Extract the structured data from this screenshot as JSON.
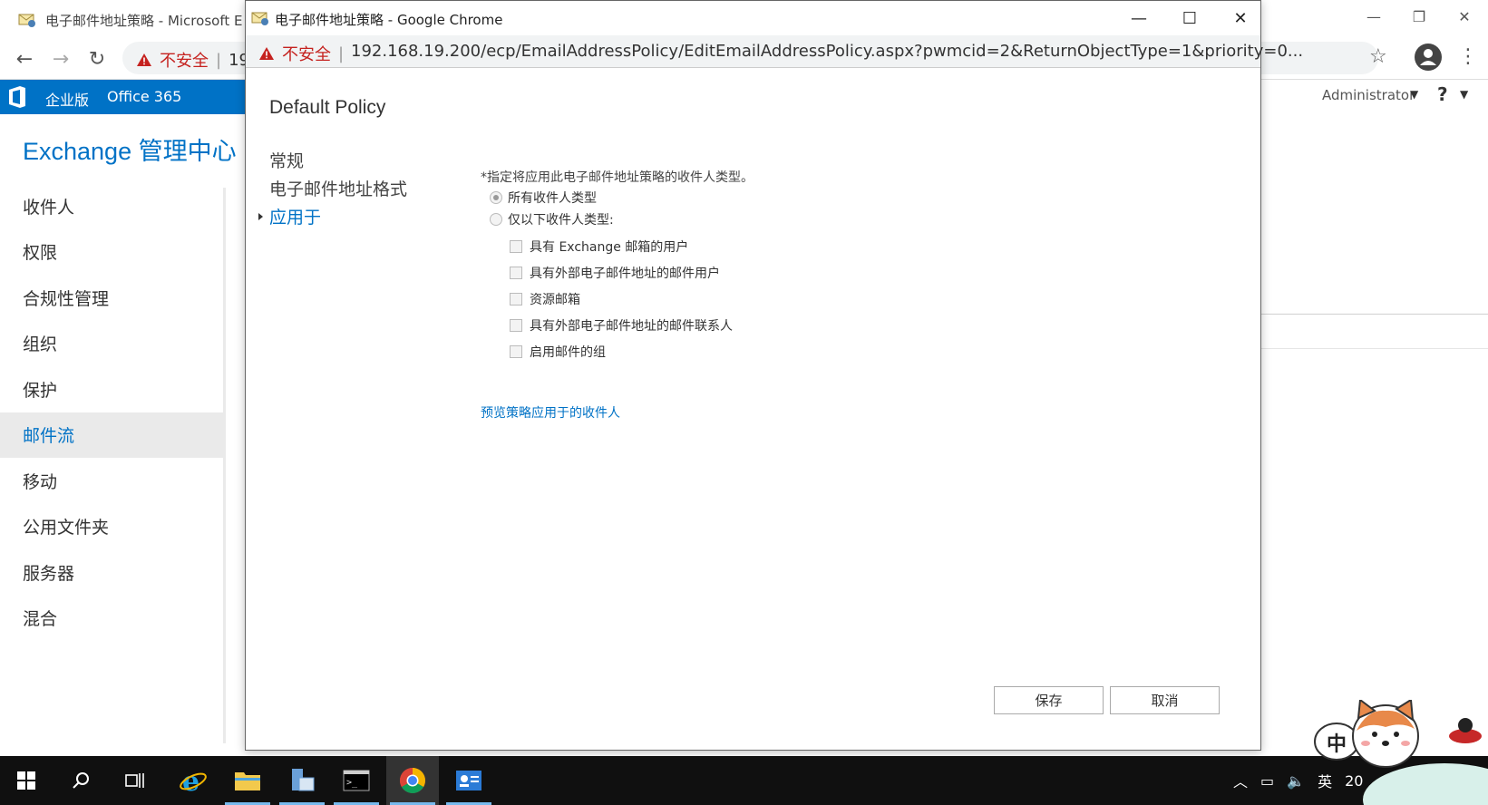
{
  "background_window": {
    "tab_title": "电子邮件地址策略 - Microsoft E",
    "security_label": "不安全",
    "url_fragment": "19"
  },
  "office_bar": {
    "enterprise_label": "企业版",
    "product_label": "Office 365",
    "user_name": "Administrator",
    "help_label": "?"
  },
  "eac": {
    "title": "Exchange 管理中心",
    "nav": [
      {
        "label": "收件人"
      },
      {
        "label": "权限"
      },
      {
        "label": "合规性管理"
      },
      {
        "label": "组织"
      },
      {
        "label": "保护"
      },
      {
        "label": "邮件流",
        "active": true
      },
      {
        "label": "移动"
      },
      {
        "label": "公用文件夹"
      },
      {
        "label": "服务器"
      },
      {
        "label": "混合"
      }
    ]
  },
  "popup": {
    "window_title": "电子邮件地址策略 - Google Chrome",
    "security_label": "不安全",
    "url": "192.168.19.200/ecp/EmailAddressPolicy/EditEmailAddressPolicy.aspx?pwmcid=2&ReturnObjectType=1&priority=0...",
    "dialog_title": "Default Policy",
    "nav": [
      {
        "label": "常规"
      },
      {
        "label": "电子邮件地址格式"
      },
      {
        "label": "应用于",
        "active": true
      }
    ],
    "instruction": "*指定将应用此电子邮件地址策略的收件人类型。",
    "radios": [
      {
        "label": "所有收件人类型",
        "checked": true
      },
      {
        "label": "仅以下收件人类型:",
        "checked": false
      }
    ],
    "checkboxes": [
      {
        "label": "具有 Exchange 邮箱的用户",
        "checked": false
      },
      {
        "label": "具有外部电子邮件地址的邮件用户",
        "checked": false
      },
      {
        "label": "资源邮箱",
        "checked": false
      },
      {
        "label": "具有外部电子邮件地址的邮件联系人",
        "checked": false
      },
      {
        "label": "启用邮件的组",
        "checked": false
      }
    ],
    "preview_link": "预览策略应用于的收件人",
    "save_label": "保存",
    "cancel_label": "取消"
  },
  "taskbar": {
    "ime_mode": "中",
    "ime_lang": "英",
    "clock_partial": "20"
  },
  "colors": {
    "accent": "#0072c6",
    "warning": "#c5221f",
    "taskbar": "#101010"
  }
}
